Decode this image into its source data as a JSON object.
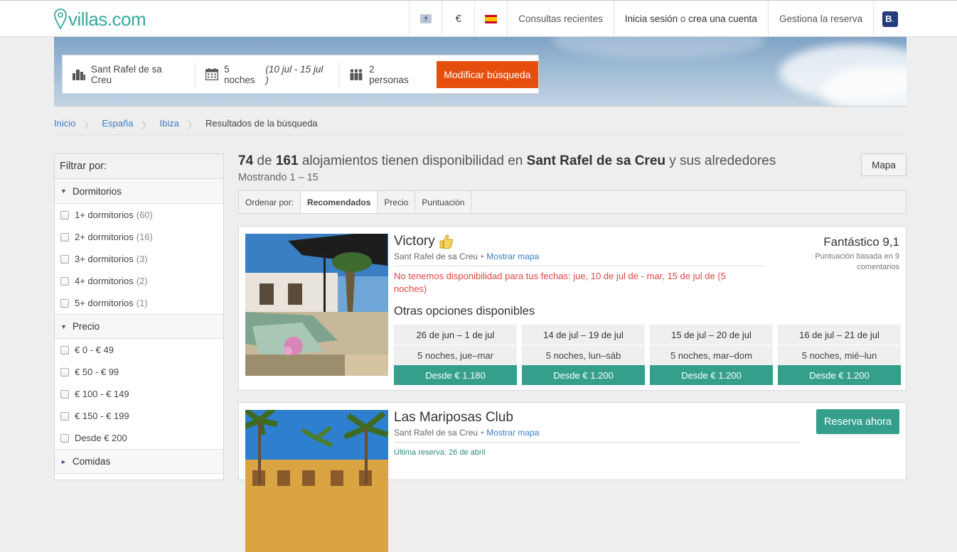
{
  "header": {
    "logo_text": "villas.com",
    "help_label": "?",
    "currency": "€",
    "nav": {
      "recent": "Consultas recientes",
      "signin_a": "Inicia sesión",
      "signin_mid": " o ",
      "signin_b": "crea una cuenta",
      "manage": "Gestiona la reserva",
      "booking_letter": "B"
    }
  },
  "search": {
    "destination": "Sant Rafel de sa Creu",
    "nights": "5 noches",
    "dates": "(10 jul - 15 jul )",
    "guests": "2 personas",
    "modify_label": "Modificar búsqueda"
  },
  "breadcrumb": {
    "items": [
      "Inicio",
      "España",
      "Ibiza"
    ],
    "current": "Resultados de la búsqueda"
  },
  "sidebar": {
    "title": "Filtrar por:",
    "bedrooms": {
      "label": "Dormitorios",
      "options": [
        {
          "label": "1+ dormitorios",
          "count": "(60)"
        },
        {
          "label": "2+ dormitorios",
          "count": "(16)"
        },
        {
          "label": "3+ dormitorios",
          "count": "(3)"
        },
        {
          "label": "4+ dormitorios",
          "count": "(2)"
        },
        {
          "label": "5+ dormitorios",
          "count": "(1)"
        }
      ]
    },
    "price": {
      "label": "Precio",
      "options": [
        "€ 0 - € 49",
        "€ 50 - € 99",
        "€ 100 - € 149",
        "€ 150 - € 199",
        "Desde € 200"
      ]
    },
    "meals": {
      "label": "Comidas"
    }
  },
  "results": {
    "available": "74",
    "of": " de ",
    "total": "161",
    "text": " alojamientos tienen disponibilidad en ",
    "place": "Sant Rafel de sa Creu",
    "suffix": " y sus alrededores",
    "showing": "Mostrando 1 – 15",
    "map_label": "Mapa"
  },
  "sort": {
    "label": "Ordenar por:",
    "options": [
      "Recomendados",
      "Precio",
      "Puntuación"
    ]
  },
  "listings": [
    {
      "name": "Victory",
      "location": "Sant Rafel de sa Creu",
      "map_link": "Mostrar mapa",
      "score_label": "Fantástico 9,1",
      "score_sub": "Puntuación basada en 9 comentarios",
      "no_avail": "No tenemos disponibilidad para tus fechas: jue, 10 de jul de - mar, 15 de jul de (5 noches)",
      "other_title": "Otras opciones disponibles",
      "options": [
        {
          "dates": "26 de jun – 1 de jul",
          "nights": "5 noches, jue–mar",
          "price": "Desde € 1.180"
        },
        {
          "dates": "14 de jul – 19 de jul",
          "nights": "5 noches, lun–sáb",
          "price": "Desde € 1.200"
        },
        {
          "dates": "15 de jul – 20 de jul",
          "nights": "5 noches, mar–dom",
          "price": "Desde € 1.200"
        },
        {
          "dates": "16 de jul – 21 de jul",
          "nights": "5 noches, mié–lun",
          "price": "Desde € 1.200"
        }
      ]
    },
    {
      "name": "Las Mariposas Club",
      "location": "Sant Rafel de sa Creu",
      "map_link": "Mostrar mapa",
      "last_booking": "Última reserva: 26 de abril",
      "reserve_label": "Reserva ahora"
    }
  ],
  "colors": {
    "brand": "#35a99c",
    "cta_orange": "#e64e0e",
    "teal_button": "#34a08c",
    "link": "#3b7ec6",
    "warning": "#e04545"
  }
}
